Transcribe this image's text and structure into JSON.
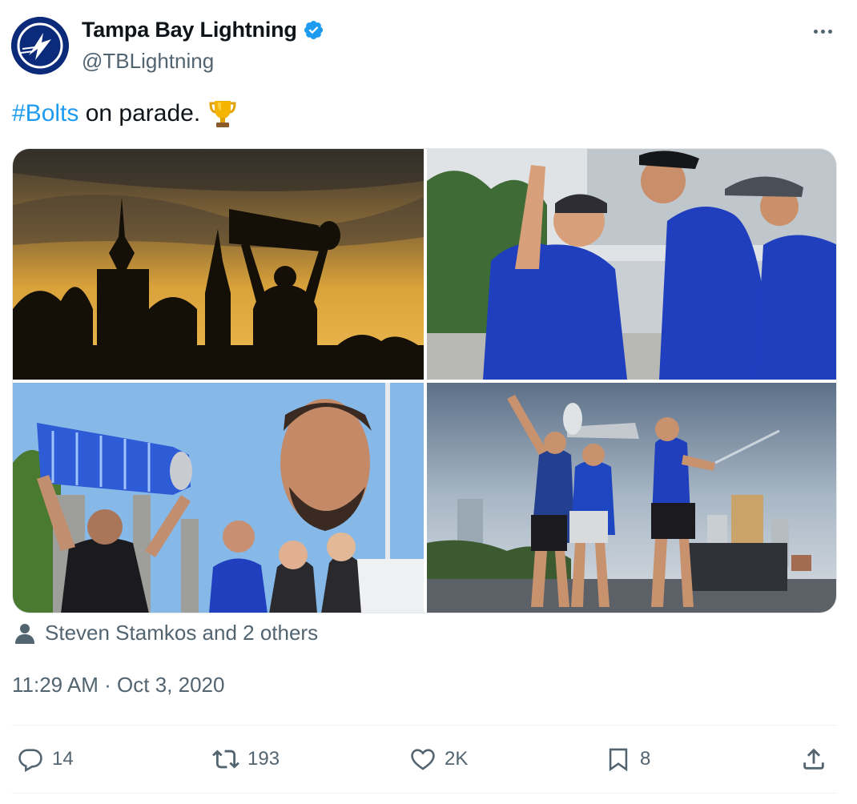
{
  "author": {
    "display_name": "Tampa Bay Lightning",
    "handle": "@TBLightning",
    "verified": true,
    "avatar_icon": "lightning-bolt-logo"
  },
  "tweet": {
    "hashtag": "#Bolts",
    "text": " on parade.",
    "emoji": "trophy-icon"
  },
  "media": [
    {
      "alt": "silhouette-cup-sunset"
    },
    {
      "alt": "players-celebrating-blue-shirts"
    },
    {
      "alt": "player-holding-beer-can-cup"
    },
    {
      "alt": "players-on-boat-with-cup"
    }
  ],
  "tagged": {
    "icon": "person-icon",
    "text": "Steven Stamkos and 2 others"
  },
  "timestamp": "11:29 AM · Oct 3, 2020",
  "actions": {
    "replies": "14",
    "retweets": "193",
    "likes": "2K",
    "bookmarks": "8"
  },
  "colors": {
    "accent": "#1d9bf0",
    "secondary_text": "#536471",
    "primary_text": "#0f1419"
  }
}
